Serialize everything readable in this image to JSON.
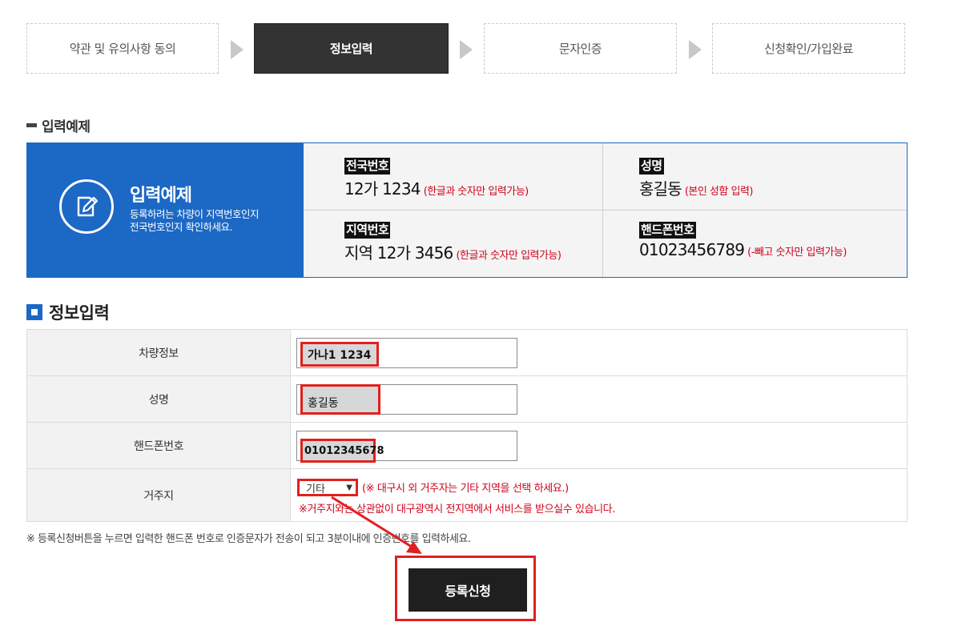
{
  "steps": [
    {
      "label": "약관 및 유의사항 동의"
    },
    {
      "label": "정보입력"
    },
    {
      "label": "문자인증"
    },
    {
      "label": "신청확인/가입완료"
    }
  ],
  "example": {
    "heading": "입력예제",
    "title": "입력예제",
    "desc_line1": "등록하려는 차량이 지역번호인지",
    "desc_line2": "전국번호인지 확인하세요.",
    "icon": "edit-document-icon",
    "cells": [
      {
        "label": "전국번호",
        "value": "12가 1234",
        "note": "(한글과 숫자만 입력가능)"
      },
      {
        "label": "성명",
        "value": "홍길동",
        "note": "(본인 성함 입력)"
      },
      {
        "label": "지역번호",
        "value": "지역 12가 3456",
        "note": "(한글과 숫자만 입력가능)"
      },
      {
        "label": "핸드폰번호",
        "value": "01023456789",
        "note": "(-빼고 숫자만 입력가능)"
      }
    ]
  },
  "form": {
    "heading": "정보입력",
    "rows": [
      {
        "label": "차량정보",
        "value": "가나1 1234"
      },
      {
        "label": "성명",
        "value": "홍길동"
      },
      {
        "label": "핸드폰번호",
        "value": "01012345678"
      },
      {
        "label": "거주지",
        "select_value": "기타",
        "note1": "(※ 대구시 외 거주자는 기타 지역을 선택 하세요.)",
        "note2": "※거주지와는 상관없이 대구광역시 전지역에서 서비스를 받으실수 있습니다."
      }
    ]
  },
  "footnote": "※ 등록신청버튼을 누르면 입력한 핸드폰 번호로 인증문자가 전송이 되고 3분이내에 인증번호를 입력하세요.",
  "submit_label": "등록신청",
  "colors": {
    "accent_blue": "#1c68c5",
    "highlight_red": "#e02020",
    "note_red": "#d0021b",
    "dark": "#333333"
  }
}
